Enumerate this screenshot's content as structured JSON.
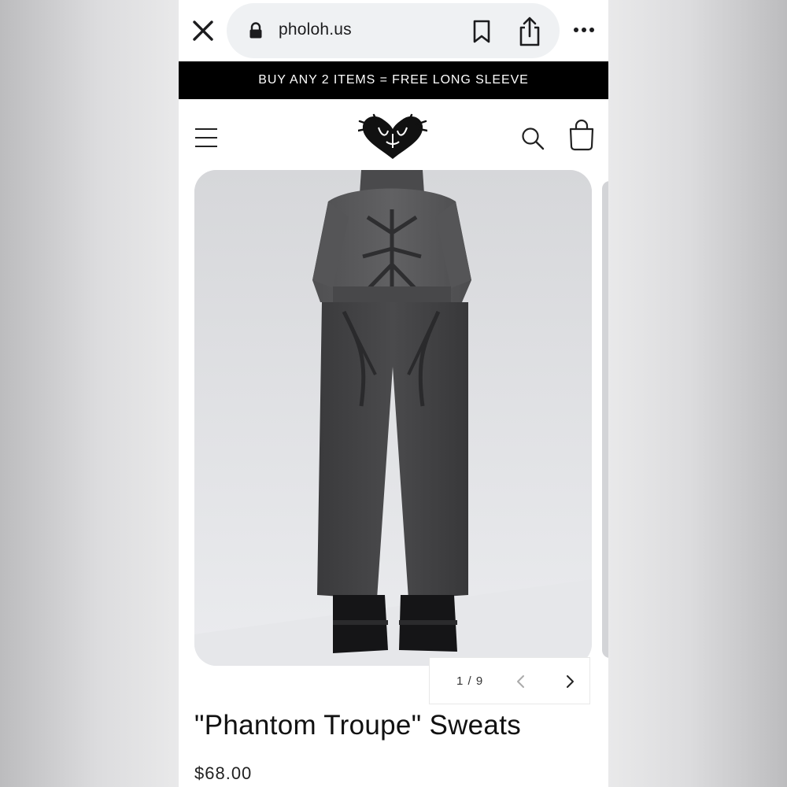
{
  "browser": {
    "url": "pholoh.us",
    "icons": [
      "close-icon",
      "lock-icon",
      "bookmark-icon",
      "share-icon",
      "more-icon"
    ]
  },
  "announcement": {
    "text": "BUY ANY 2 ITEMS = FREE LONG SLEEVE"
  },
  "header": {
    "icons": [
      "hamburger-menu-icon",
      "brand-logo",
      "search-icon",
      "shopping-bag-icon"
    ]
  },
  "gallery": {
    "counter": "1 / 9",
    "icons": [
      "chevron-left-icon",
      "chevron-right-icon"
    ]
  },
  "product": {
    "title": "\"Phantom Troupe\" Sweats",
    "price": "$68.00"
  },
  "colors": {
    "announcement_bg": "#000000",
    "url_pill_bg": "#eff1f3",
    "text": "#111111"
  }
}
